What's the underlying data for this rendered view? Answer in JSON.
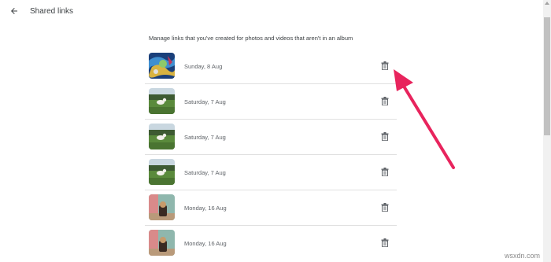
{
  "header": {
    "back_icon": "arrow-back-icon",
    "title": "Shared links"
  },
  "main": {
    "description": "Manage links that you've created for photos and videos that aren't in an album",
    "rows": [
      {
        "date": "Sunday, 8 Aug",
        "thumbnail": "abstract-blue-photo",
        "delete_icon": "trash-icon"
      },
      {
        "date": "Saturday, 7 Aug",
        "thumbnail": "park-dog-photo",
        "delete_icon": "trash-icon"
      },
      {
        "date": "Saturday, 7 Aug",
        "thumbnail": "park-dog-photo",
        "delete_icon": "trash-icon"
      },
      {
        "date": "Saturday, 7 Aug",
        "thumbnail": "park-dog-photo",
        "delete_icon": "trash-icon"
      },
      {
        "date": "Monday, 16 Aug",
        "thumbnail": "indoor-object-photo",
        "delete_icon": "trash-icon"
      },
      {
        "date": "Monday, 16 Aug",
        "thumbnail": "indoor-object-photo",
        "delete_icon": "trash-icon"
      }
    ]
  },
  "annotation": {
    "arrow_color": "#e8245d"
  },
  "watermark": "wsxdn.com"
}
